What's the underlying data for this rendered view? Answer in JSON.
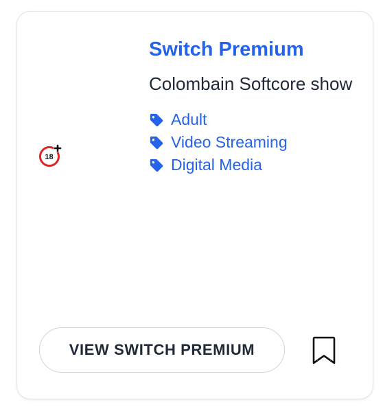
{
  "card": {
    "title": "Switch Premium",
    "description": "Colombain Softcore show",
    "logo_icon": "adult-18-plus-icon",
    "tags": [
      {
        "label": "Adult",
        "icon": "tag-icon"
      },
      {
        "label": "Video Streaming",
        "icon": "tag-icon"
      },
      {
        "label": "Digital Media",
        "icon": "tag-icon"
      }
    ],
    "view_button_label": "VIEW SWITCH PREMIUM",
    "bookmark_icon": "bookmark-icon"
  },
  "colors": {
    "accent": "#2563eb",
    "text": "#1f2937",
    "border": "#e2e4e8",
    "logo_red": "#dc2626"
  }
}
